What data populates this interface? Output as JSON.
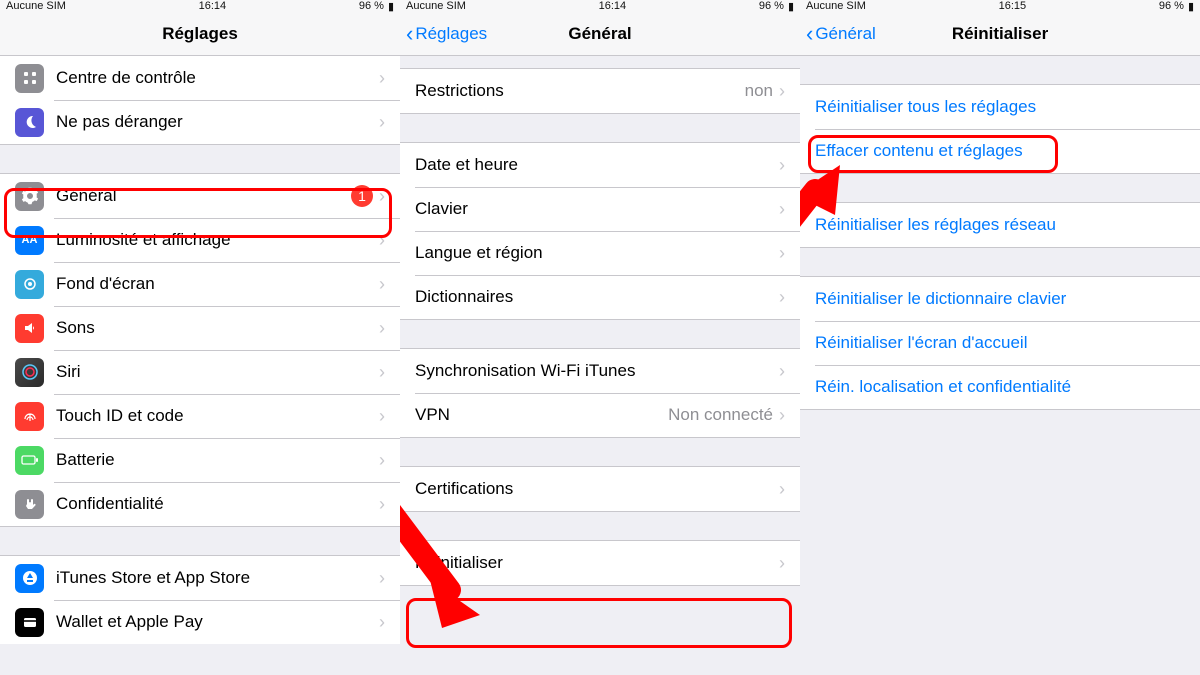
{
  "status": {
    "carrier": "Aucune SIM",
    "time1": "16:14",
    "time2": "16:14",
    "time3": "16:15",
    "battery": "96 %",
    "battery_icon": "■"
  },
  "screen1": {
    "title": "Réglages",
    "rows": {
      "control": "Centre de contrôle",
      "dnd": "Ne pas déranger",
      "general": "Général",
      "general_badge": "1",
      "display": "Luminosité et affichage",
      "wallpaper": "Fond d'écran",
      "sounds": "Sons",
      "siri": "Siri",
      "touchid": "Touch ID et code",
      "battery": "Batterie",
      "privacy": "Confidentialité",
      "itunes": "iTunes Store et App Store",
      "wallet": "Wallet et Apple Pay"
    }
  },
  "screen2": {
    "back": "Réglages",
    "title": "Général",
    "rows": {
      "restrictions": "Restrictions",
      "restrictions_detail": "non",
      "datetime": "Date et heure",
      "keyboard": "Clavier",
      "language": "Langue et région",
      "dictionaries": "Dictionnaires",
      "itunes_wifi": "Synchronisation Wi-Fi iTunes",
      "vpn": "VPN",
      "vpn_detail": "Non connecté",
      "certifications": "Certifications",
      "reset": "Réinitialiser"
    }
  },
  "screen3": {
    "back": "Général",
    "title": "Réinitialiser",
    "rows": {
      "reset_all": "Réinitialiser tous les réglages",
      "erase_all": "Effacer contenu et réglages",
      "reset_network": "Réinitialiser les réglages réseau",
      "reset_keyboard": "Réinitialiser le dictionnaire clavier",
      "reset_home": "Réinitialiser l'écran d'accueil",
      "reset_location": "Réin. localisation et confidentialité"
    }
  }
}
